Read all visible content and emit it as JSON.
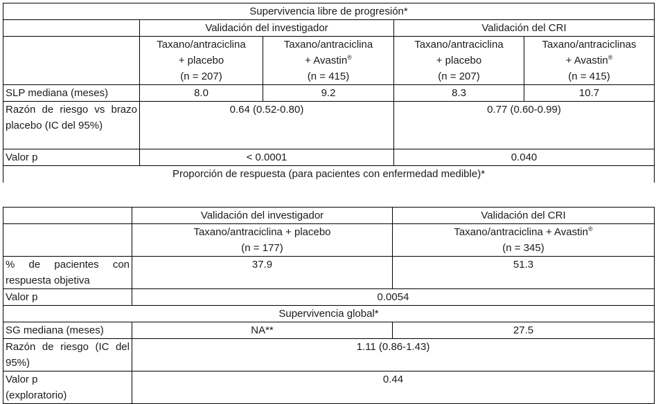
{
  "table1": {
    "pfs_title": "Supervivencia libre de progresión*",
    "inv_header": "Validación del investigador",
    "cri_header": "Validación del CRI",
    "arms": {
      "inv_placebo": {
        "line1": "Taxano/antraciclina",
        "line2": "+ placebo",
        "line3": "(n = 207)"
      },
      "inv_avastin": {
        "line1": "Taxano/antraciclina",
        "line2": "+ Avastin",
        "sup": "®",
        "line3": "(n = 415)"
      },
      "cri_placebo": {
        "line1": "Taxano/antraciclina",
        "line2": "+ placebo",
        "line3": "(n = 207)"
      },
      "cri_avastin": {
        "line1": "Taxano/antraciclinas",
        "line2": "+ Avastin",
        "sup": "®",
        "line3": "(n = 415)"
      }
    },
    "rows": {
      "slp_label": "SLP mediana (meses)",
      "slp_values": [
        "8.0",
        "9.2",
        "8.3",
        "10.7"
      ],
      "hr_label": "Razón de riesgo vs brazo placebo (IC del 95%)",
      "hr_inv": "0.64 (0.52-0.80)",
      "hr_cri": "0.77 (0.60-0.99)",
      "p_label": "Valor p",
      "p_inv": "< 0.0001",
      "p_cri": "0.040"
    },
    "response_title": "Proporción de respuesta (para pacientes con enfermedad medible)*"
  },
  "table2": {
    "inv_header": "Validación del investigador",
    "cri_header": "Validación del CRI",
    "arm_placebo": {
      "line1": "Taxano/antraciclina + placebo",
      "line2": "(n = 177)"
    },
    "arm_avastin": {
      "line1": "Taxano/antraciclina + Avastin",
      "sup": "®",
      "line2": "(n = 345)"
    },
    "orr_label": "% de pacientes con respuesta objetiva",
    "orr_placebo": "37.9",
    "orr_avastin": "51.3",
    "p_label": "Valor p",
    "p_value": "0.0054",
    "os_title": "Supervivencia global*",
    "os_label": "SG mediana (meses)",
    "os_placebo": "NA**",
    "os_avastin": "27.5",
    "os_hr_label": "Razón de riesgo (IC del 95%)",
    "os_hr": "1.11 (0.86-1.43)",
    "os_p_label_1": "Valor p",
    "os_p_label_2": "(exploratorio)",
    "os_p": "0.44"
  }
}
